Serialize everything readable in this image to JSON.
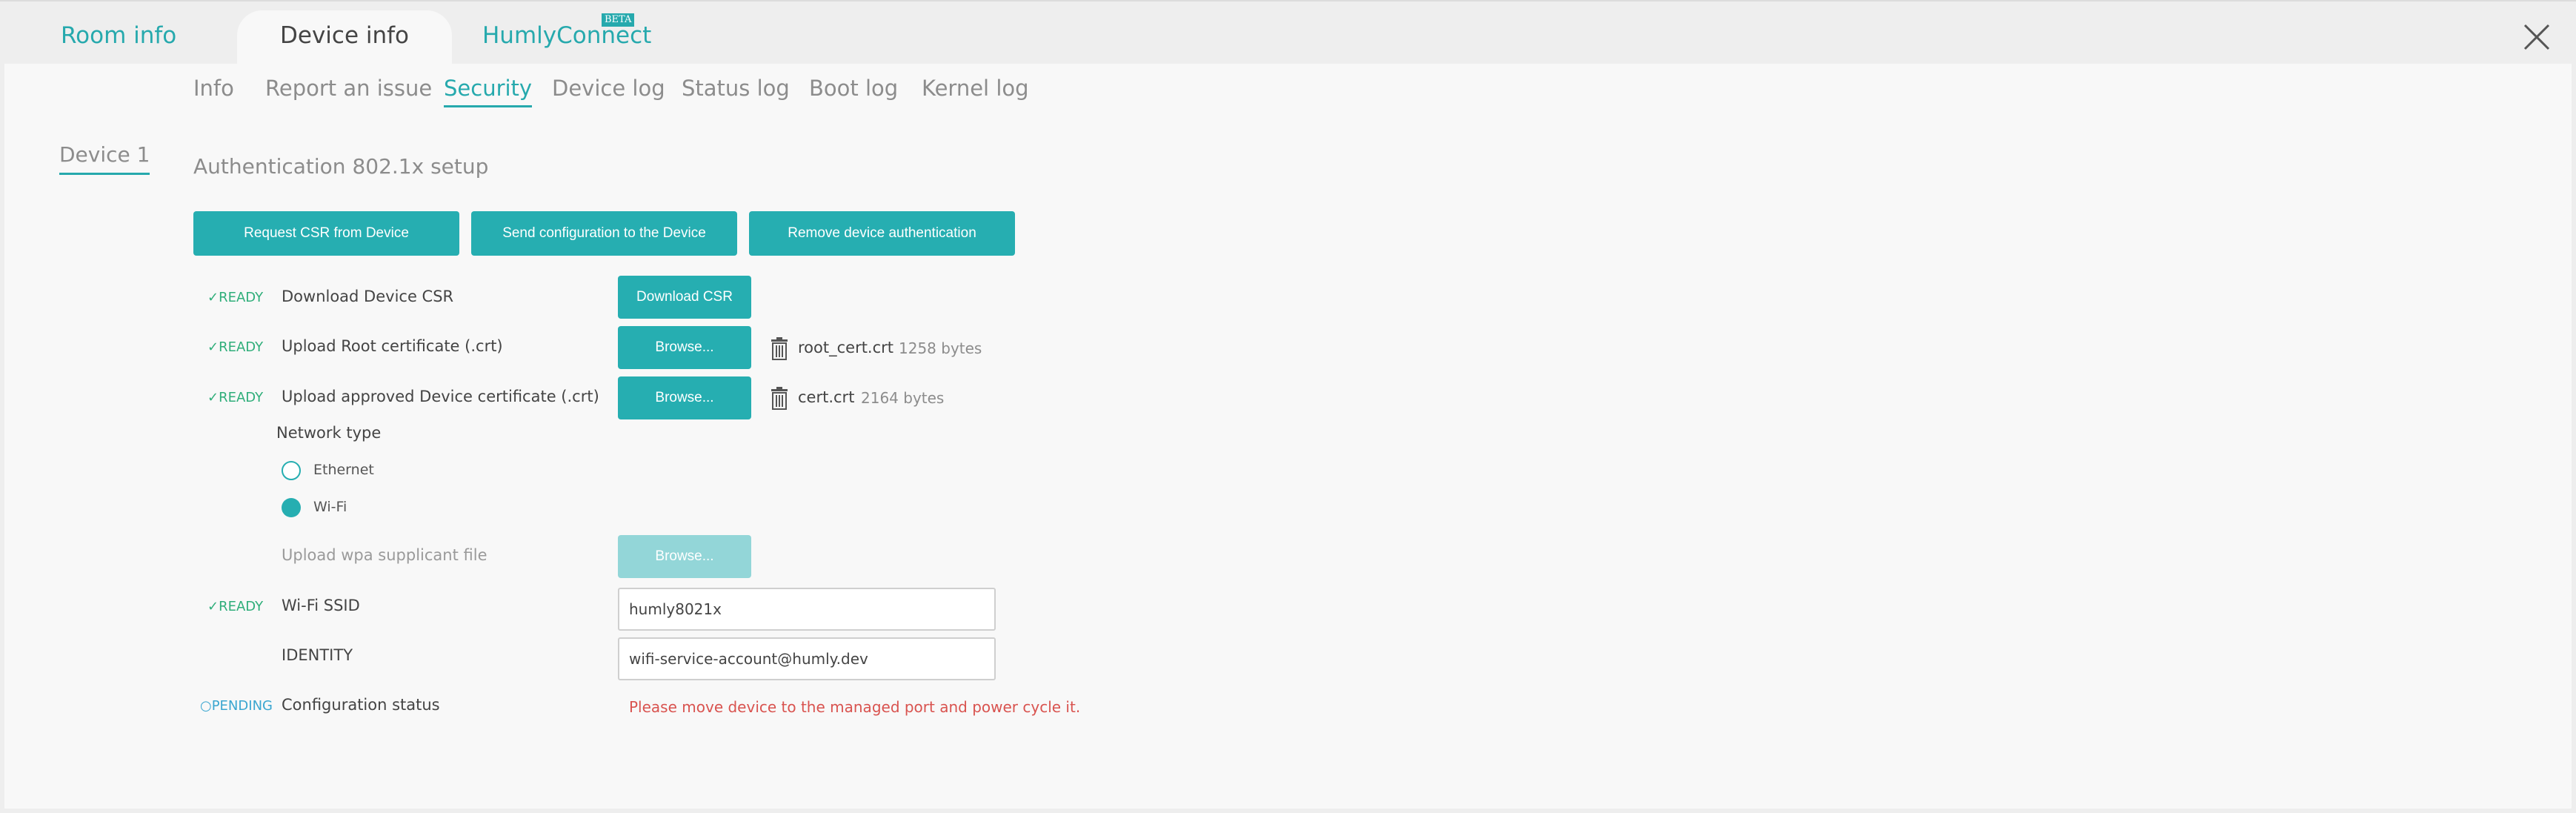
{
  "top_tabs": {
    "room_info": "Room info",
    "device_info": "Device info",
    "humly_connect": "HumlyConnect",
    "beta_badge": "BETA"
  },
  "sub_tabs": {
    "info": "Info",
    "report": "Report an issue",
    "security": "Security",
    "device_log": "Device log",
    "status_log": "Status log",
    "boot_log": "Boot log",
    "kernel_log": "Kernel log"
  },
  "device_tab": "Device 1",
  "section_title": "Authentication 802.1x setup",
  "actions": {
    "request_csr": "Request CSR from Device",
    "send_config": "Send configuration to the Device",
    "remove_auth": "Remove device authentication"
  },
  "rows": {
    "download_csr": {
      "status": "✓READY",
      "label": "Download Device CSR",
      "button": "Download CSR"
    },
    "root_cert": {
      "status": "✓READY",
      "label": "Upload Root certificate (.crt)",
      "button": "Browse...",
      "file_name": "root_cert.crt",
      "file_size": "1258 bytes"
    },
    "device_cert": {
      "status": "✓READY",
      "label": "Upload approved Device certificate (.crt)",
      "button": "Browse...",
      "file_name": "cert.crt",
      "file_size": "2164 bytes"
    },
    "network_type": {
      "label": "Network type",
      "ethernet": "Ethernet",
      "wifi": "Wi-Fi",
      "selected": "Wi-Fi"
    },
    "wpa": {
      "label": "Upload wpa supplicant file",
      "button": "Browse..."
    },
    "ssid": {
      "status": "✓READY",
      "label": "Wi-Fi SSID",
      "value": "humly8021x"
    },
    "identity": {
      "label": "IDENTITY",
      "value": "wifi-service-account@humly.dev"
    },
    "config_status": {
      "status": "○PENDING",
      "label": "Configuration status",
      "message": "Please move device to the managed port and power cycle it."
    }
  },
  "colors": {
    "accent": "#26aeb1",
    "ready": "#2fae7a",
    "pending": "#3aa6d0",
    "error": "#d9534f"
  }
}
